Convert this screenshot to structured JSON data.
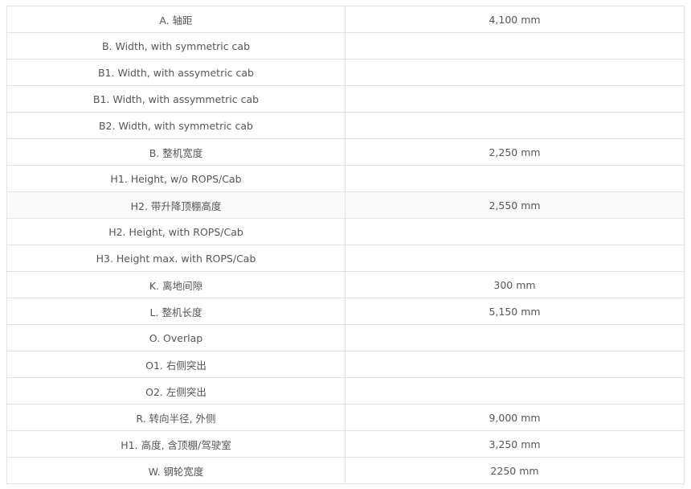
{
  "specs": [
    {
      "label": "A. 轴距",
      "value": "4,100 mm"
    },
    {
      "label": "B. Width, with symmetric cab",
      "value": ""
    },
    {
      "label": "B1. Width, with assymetric cab",
      "value": ""
    },
    {
      "label": "B1. Width, with assymmetric cab",
      "value": ""
    },
    {
      "label": "B2. Width, with symmetric cab",
      "value": ""
    },
    {
      "label": "B. 整机宽度",
      "value": "2,250 mm"
    },
    {
      "label": "H1. Height, w/o ROPS/Cab",
      "value": ""
    },
    {
      "label": "H2. 带升降顶棚高度",
      "value": "2,550 mm"
    },
    {
      "label": "H2. Height, with ROPS/Cab",
      "value": ""
    },
    {
      "label": "H3. Height max. with ROPS/Cab",
      "value": ""
    },
    {
      "label": "K. 离地间隙",
      "value": "300 mm"
    },
    {
      "label": "L. 整机长度",
      "value": "5,150 mm"
    },
    {
      "label": "O. Overlap",
      "value": ""
    },
    {
      "label": "O1. 右侧突出",
      "value": ""
    },
    {
      "label": "O2. 左侧突出",
      "value": ""
    },
    {
      "label": "R. 转向半径, 外侧",
      "value": "9,000 mm"
    },
    {
      "label": "H1. 高度, 含顶棚/驾驶室",
      "value": "3,250 mm"
    },
    {
      "label": "W. 钢轮宽度",
      "value": "2250 mm"
    }
  ]
}
